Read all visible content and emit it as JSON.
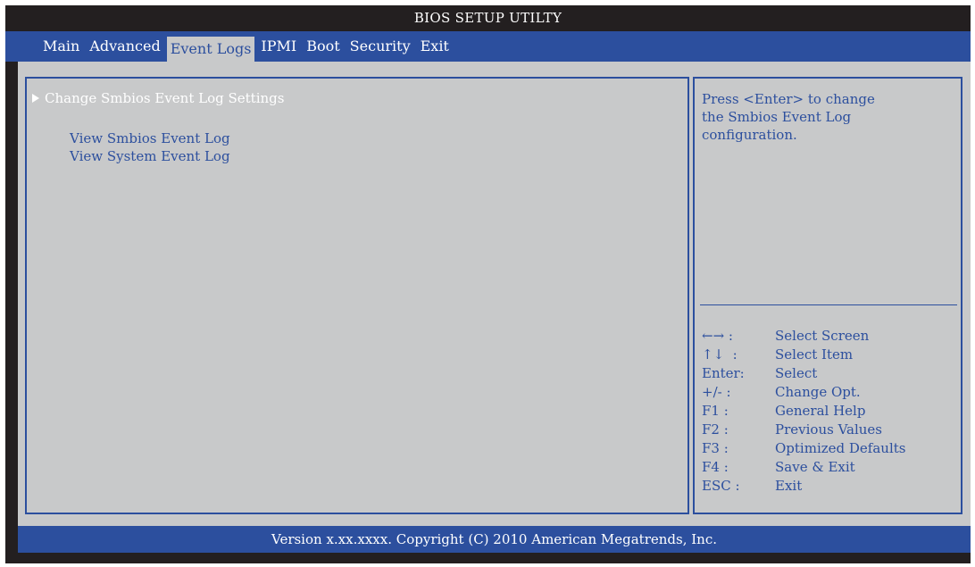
{
  "title": "BIOS SETUP UTILTY",
  "menu": [
    {
      "label": "Main"
    },
    {
      "label": "Advanced"
    },
    {
      "label": "Event Logs"
    },
    {
      "label": "IPMI"
    },
    {
      "label": "Boot"
    },
    {
      "label": "Security"
    },
    {
      "label": "Exit"
    }
  ],
  "active_menu": "Event Logs",
  "options": [
    {
      "label": "Change Smbios Event Log Settings",
      "submenu": true,
      "selected": true
    },
    {
      "label": "View Smbios Event Log",
      "submenu": false,
      "selected": false
    },
    {
      "label": "View System Event Log",
      "submenu": false,
      "selected": false
    }
  ],
  "help": {
    "line1": "Press <Enter> to change",
    "line2": "the Smbios Event Log",
    "line3": "configuration."
  },
  "keys": [
    {
      "key": "←→ :",
      "desc": "Select Screen"
    },
    {
      "key": "↑↓  :",
      "desc": "Select Item"
    },
    {
      "key": "Enter:",
      "desc": "Select"
    },
    {
      "key": "+/- :",
      "desc": "Change Opt."
    },
    {
      "key": "F1 :",
      "desc": "General Help"
    },
    {
      "key": "F2 :",
      "desc": "Previous Values"
    },
    {
      "key": "F3 :",
      "desc": "Optimized Defaults"
    },
    {
      "key": "F4 :",
      "desc": "Save & Exit"
    },
    {
      "key": "ESC :",
      "desc": "Exit"
    }
  ],
  "footer": "Version x.xx.xxxx. Copyright (C) 2010 American Megatrends, Inc.",
  "colors": {
    "frame": "#231f20",
    "accent_blue": "#2c4f9e",
    "panel_gray": "#c8c9ca",
    "text_white": "#ffffff"
  }
}
